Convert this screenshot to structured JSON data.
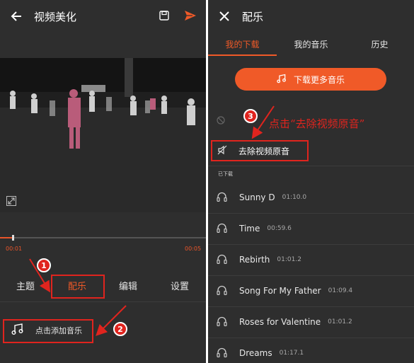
{
  "left": {
    "header": {
      "title": "视频美化"
    },
    "video": {
      "current_time": "00:01",
      "total_time": "00:05",
      "progress": 0.2
    },
    "tabs": [
      {
        "label": "主题",
        "active": false
      },
      {
        "label": "配乐",
        "active": true
      },
      {
        "label": "编辑",
        "active": false
      },
      {
        "label": "设置",
        "active": false
      }
    ],
    "add_music": {
      "label": "点击添加音乐"
    }
  },
  "right": {
    "header": {
      "title": "配乐"
    },
    "tabs": [
      {
        "label": "我的下载",
        "active": true
      },
      {
        "label": "我的音乐",
        "active": false
      },
      {
        "label": "历史",
        "active": false
      }
    ],
    "download_more": {
      "label": "下载更多音乐"
    },
    "remove_original": {
      "label": "去除视频原音"
    },
    "downloaded_label": "已下载",
    "songs": [
      {
        "name": "Sunny D",
        "duration": "01:10.0"
      },
      {
        "name": "Time",
        "duration": "00:59.6"
      },
      {
        "name": "Rebirth",
        "duration": "01:01.2"
      },
      {
        "name": "Song For My Father",
        "duration": "01:09.4"
      },
      {
        "name": "Roses for Valentine",
        "duration": "01:01.2"
      },
      {
        "name": "Dreams",
        "duration": "01:17.1"
      }
    ]
  },
  "annotations": {
    "step1": "1",
    "step2": "2",
    "step3": "3",
    "callout": "点击“去除视频原音”"
  },
  "colors": {
    "accent": "#f05a28",
    "annotation_red": "#e0241e",
    "panel_bg": "#2e2e2e"
  }
}
